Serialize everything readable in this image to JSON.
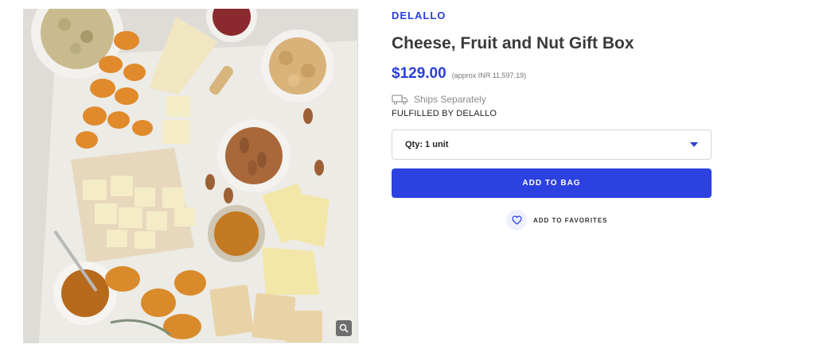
{
  "product": {
    "brand": "DELALLO",
    "title": "Cheese, Fruit and Nut Gift Box",
    "price": "$129.00",
    "approx_price": "(approx INR 11,597.19)",
    "ships_note": "Ships Separately",
    "fulfilled_by": "FULFILLED BY DELALLO"
  },
  "quantity": {
    "selected": "Qty: 1 unit"
  },
  "actions": {
    "add_to_bag": "ADD TO BAG",
    "add_to_favorites": "ADD TO FAVORITES"
  },
  "icons": {
    "truck": "truck-icon",
    "heart": "heart-icon",
    "zoom": "zoom-icon",
    "caret": "chevron-down-icon"
  },
  "colors": {
    "accent": "#2b41e0",
    "brand_text": "#2a3fd8"
  }
}
